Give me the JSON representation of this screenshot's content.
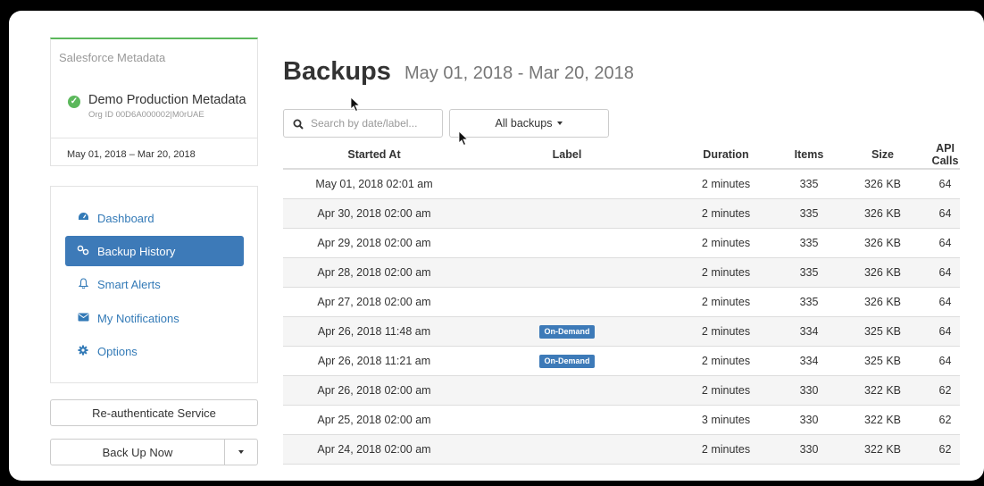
{
  "account": {
    "service": "Salesforce Metadata",
    "name": "Demo Production Metadata",
    "org_id": "Org ID 00D6A000002|M0rUAE",
    "date_range": "May 01, 2018 – Mar 20, 2018"
  },
  "nav": {
    "items": [
      {
        "label": "Dashboard",
        "icon": "dashboard-icon"
      },
      {
        "label": "Backup History",
        "icon": "backup-history-icon",
        "active": true
      },
      {
        "label": "Smart Alerts",
        "icon": "bell-icon"
      },
      {
        "label": "My Notifications",
        "icon": "envelope-icon"
      },
      {
        "label": "Options",
        "icon": "gear-icon"
      }
    ]
  },
  "actions": {
    "reauth_label": "Re-authenticate Service",
    "backup_now_label": "Back Up Now"
  },
  "main": {
    "title": "Backups",
    "subtitle": "May 01, 2018 - Mar 20, 2018",
    "search_placeholder": "Search by date/label...",
    "filter_label": "All backups"
  },
  "table": {
    "headers": [
      "Started At",
      "Label",
      "Duration",
      "Items",
      "Size",
      "API Calls"
    ],
    "rows": [
      {
        "started": "May 01, 2018 02:01 am",
        "label": "",
        "duration": "2 minutes",
        "items": "335",
        "size": "326 KB",
        "api": "64"
      },
      {
        "started": "Apr 30, 2018 02:00 am",
        "label": "",
        "duration": "2 minutes",
        "items": "335",
        "size": "326 KB",
        "api": "64"
      },
      {
        "started": "Apr 29, 2018 02:00 am",
        "label": "",
        "duration": "2 minutes",
        "items": "335",
        "size": "326 KB",
        "api": "64"
      },
      {
        "started": "Apr 28, 2018 02:00 am",
        "label": "",
        "duration": "2 minutes",
        "items": "335",
        "size": "326 KB",
        "api": "64"
      },
      {
        "started": "Apr 27, 2018 02:00 am",
        "label": "",
        "duration": "2 minutes",
        "items": "335",
        "size": "326 KB",
        "api": "64"
      },
      {
        "started": "Apr 26, 2018 11:48 am",
        "label": "On-Demand",
        "duration": "2 minutes",
        "items": "334",
        "size": "325 KB",
        "api": "64"
      },
      {
        "started": "Apr 26, 2018 11:21 am",
        "label": "On-Demand",
        "duration": "2 minutes",
        "items": "334",
        "size": "325 KB",
        "api": "64"
      },
      {
        "started": "Apr 26, 2018 02:00 am",
        "label": "",
        "duration": "2 minutes",
        "items": "330",
        "size": "322 KB",
        "api": "62"
      },
      {
        "started": "Apr 25, 2018 02:00 am",
        "label": "",
        "duration": "3 minutes",
        "items": "330",
        "size": "322 KB",
        "api": "62"
      },
      {
        "started": "Apr 24, 2018 02:00 am",
        "label": "",
        "duration": "2 minutes",
        "items": "330",
        "size": "322 KB",
        "api": "62"
      }
    ]
  },
  "colors": {
    "accent": "#3d7ab8",
    "success": "#5cb85c",
    "link": "#337ab7"
  }
}
